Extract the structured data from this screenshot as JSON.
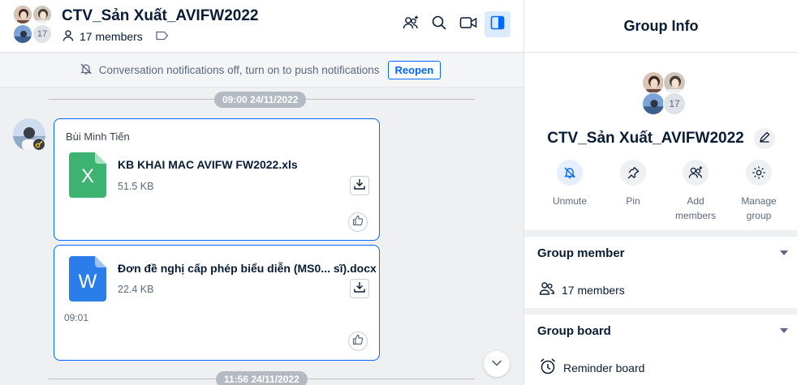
{
  "header": {
    "title": "CTV_Sản Xuất_AVIFW2022",
    "members": "17 members",
    "avatar_count": "17"
  },
  "notification": {
    "text": "Conversation notifications off, turn on to push notifications",
    "button": "Reopen"
  },
  "timeline": {
    "stamp1": "09:00 24/11/2022",
    "stamp2": "11:56 24/11/2022"
  },
  "messages": {
    "sender": "Bùi Minh Tiến",
    "file1": {
      "icon_letter": "X",
      "name": "KB KHAI MAC AVIFW FW2022.xls",
      "size": "51.5 KB"
    },
    "file2": {
      "icon_letter": "W",
      "name": "Đơn đề nghị cấp phép biểu diễn (MS0...  sĩ).docx",
      "size": "22.4 KB",
      "time": "09:01"
    }
  },
  "info_panel": {
    "header": "Group Info",
    "avatar_count": "17",
    "group_name": "CTV_Sản Xuất_AVIFW2022",
    "actions": [
      {
        "label1": "Unmute",
        "label2": ""
      },
      {
        "label1": "Pin",
        "label2": ""
      },
      {
        "label1": "Add",
        "label2": "members"
      },
      {
        "label1": "Manage",
        "label2": "group"
      }
    ],
    "group_member": {
      "title": "Group member",
      "row": "17 members"
    },
    "group_board": {
      "title": "Group board",
      "row": "Reminder board"
    }
  },
  "colors": {
    "accent": "#0068ff",
    "excel": "#3cb371",
    "word": "#2b7de9"
  }
}
